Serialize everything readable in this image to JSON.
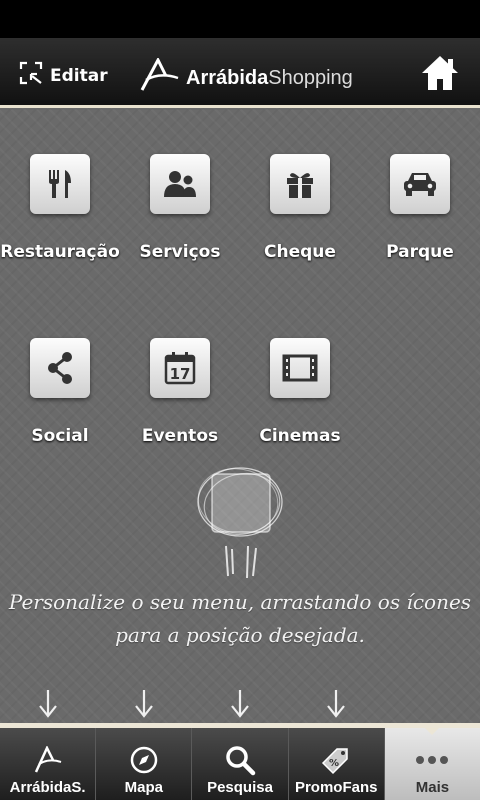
{
  "header": {
    "edit_label": "Editar",
    "logo_bold": "Arrábida",
    "logo_light": "Shopping"
  },
  "menu": {
    "tiles": [
      {
        "label": "Restauração",
        "icon": "fork-knife-icon"
      },
      {
        "label": "Serviços",
        "icon": "people-icon"
      },
      {
        "label": "Cheque",
        "icon": "gift-icon"
      },
      {
        "label": "Parque",
        "icon": "car-icon"
      },
      {
        "label": "Social",
        "icon": "share-icon"
      },
      {
        "label": "Eventos",
        "icon": "calendar-icon",
        "calendar_day": "17"
      },
      {
        "label": "Cinemas",
        "icon": "film-icon"
      }
    ],
    "hint_line1": "Personalize o seu menu, arrastando os ícones",
    "hint_line2": "para a posição desejada."
  },
  "tabbar": {
    "items": [
      {
        "label": "ArrábidaS.",
        "icon": "arrabida-logo-icon"
      },
      {
        "label": "Mapa",
        "icon": "compass-icon"
      },
      {
        "label": "Pesquisa",
        "icon": "search-icon"
      },
      {
        "label": "PromoFans",
        "icon": "tag-icon",
        "tag_text": "%"
      },
      {
        "label": "Mais",
        "icon": "more-dots-icon",
        "active": true
      }
    ]
  },
  "colors": {
    "background": "#6a6a6a",
    "accent": "#ece6d6"
  }
}
